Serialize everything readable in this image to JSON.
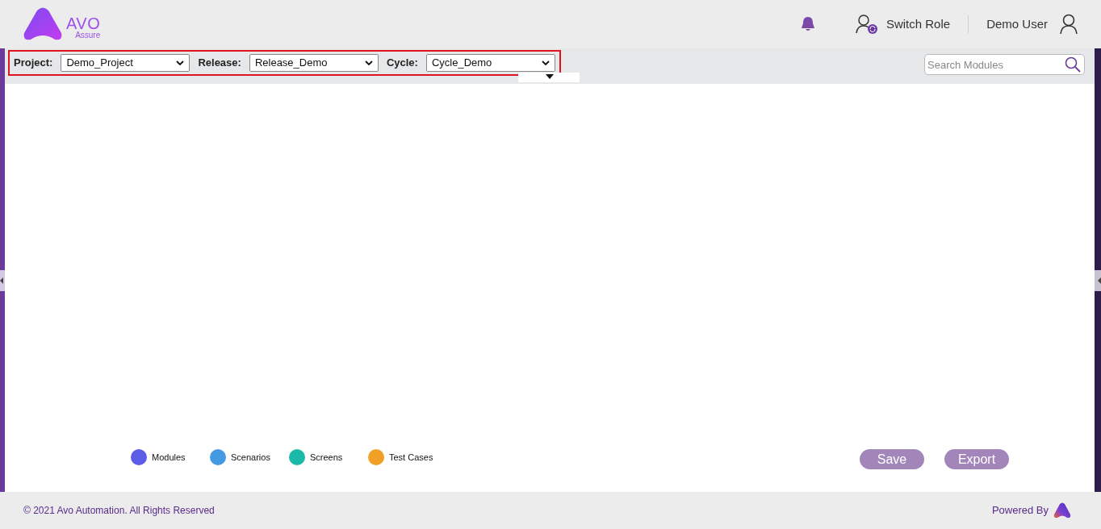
{
  "header": {
    "logo": {
      "name": "AVO",
      "tagline": "Assure"
    },
    "switch_role": "Switch Role",
    "user": "Demo User"
  },
  "toolbar": {
    "filters": [
      {
        "label": "Project:",
        "value": "Demo_Project"
      },
      {
        "label": "Release:",
        "value": "Release_Demo"
      },
      {
        "label": "Cycle:",
        "value": "Cycle_Demo"
      }
    ],
    "search": {
      "placeholder": "Search Modules"
    }
  },
  "legend": [
    {
      "label": "Modules",
      "color": "#5c5ce6"
    },
    {
      "label": "Scenarios",
      "color": "#4499e3"
    },
    {
      "label": "Screens",
      "color": "#1ab9a8"
    },
    {
      "label": "Test Cases",
      "color": "#f0a026"
    }
  ],
  "buttons": [
    {
      "label": "Save",
      "disabled": true
    },
    {
      "label": "Export",
      "disabled": true
    }
  ],
  "footer": {
    "copyright": "© 2021 Avo Automation. All Rights Reserved",
    "powered_by": "Powered By"
  }
}
